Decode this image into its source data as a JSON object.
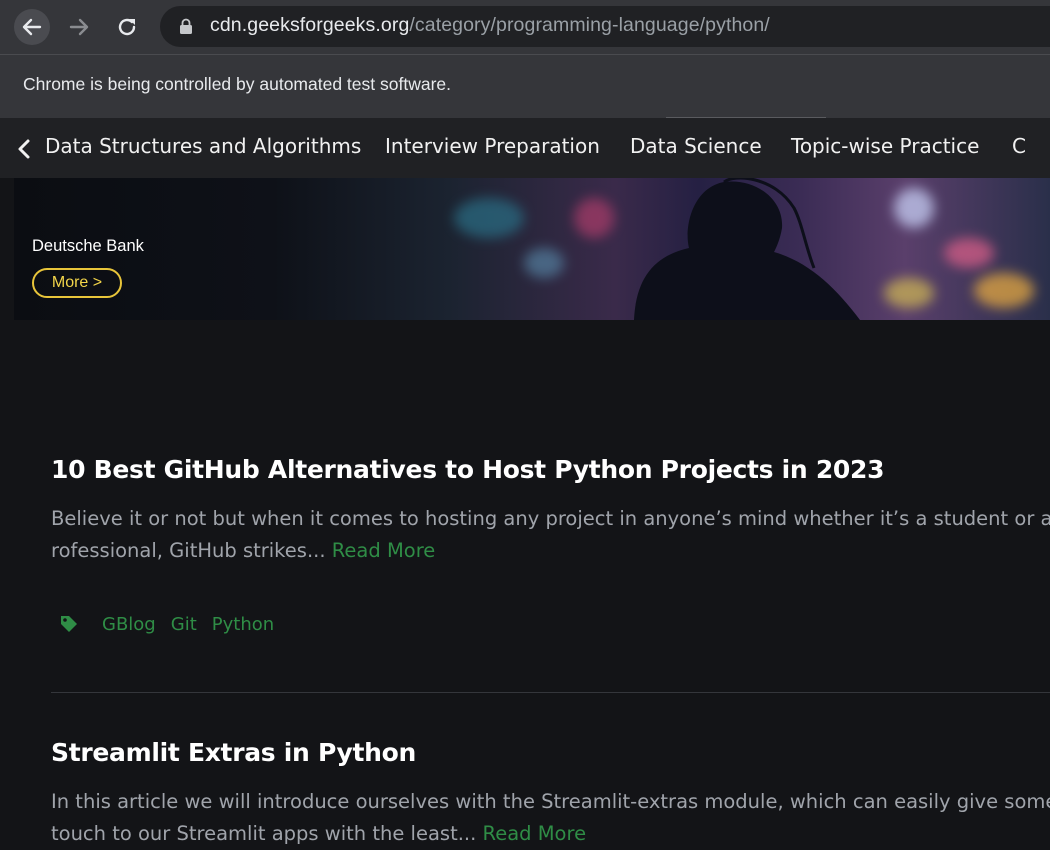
{
  "browser": {
    "url_host": "cdn.geeksforgeeks.org",
    "url_path": "/category/programming-language/python/",
    "infobar_text": "Chrome is being controlled by automated test software."
  },
  "site_nav": {
    "items": [
      "Data Structures and Algorithms",
      "Interview Preparation",
      "Data Science",
      "Topic-wise Practice",
      "C"
    ]
  },
  "banner": {
    "brand": "Deutsche Bank",
    "button_label": "More >",
    "accent_color": "#e8c53a"
  },
  "articles": [
    {
      "title": "10 Best GitHub Alternatives to Host Python Projects in 2023",
      "excerpt_line1": "Believe it or not but when it comes to hosting any project in anyone’s mind whether it’s a student or a we",
      "excerpt_line2": "rofessional, GitHub strikes...",
      "read_more": "Read More",
      "tags": [
        "GBlog",
        "Git",
        "Python"
      ]
    },
    {
      "title": "Streamlit Extras in Python",
      "excerpt_line1": "In this article we will introduce ourselves with the Streamlit-extras module, which can easily give some",
      "excerpt_line2": "touch to our Streamlit apps with the least...",
      "read_more": "Read More"
    }
  ],
  "colors": {
    "page_bg": "#131417",
    "link_green": "#2f8d46"
  }
}
